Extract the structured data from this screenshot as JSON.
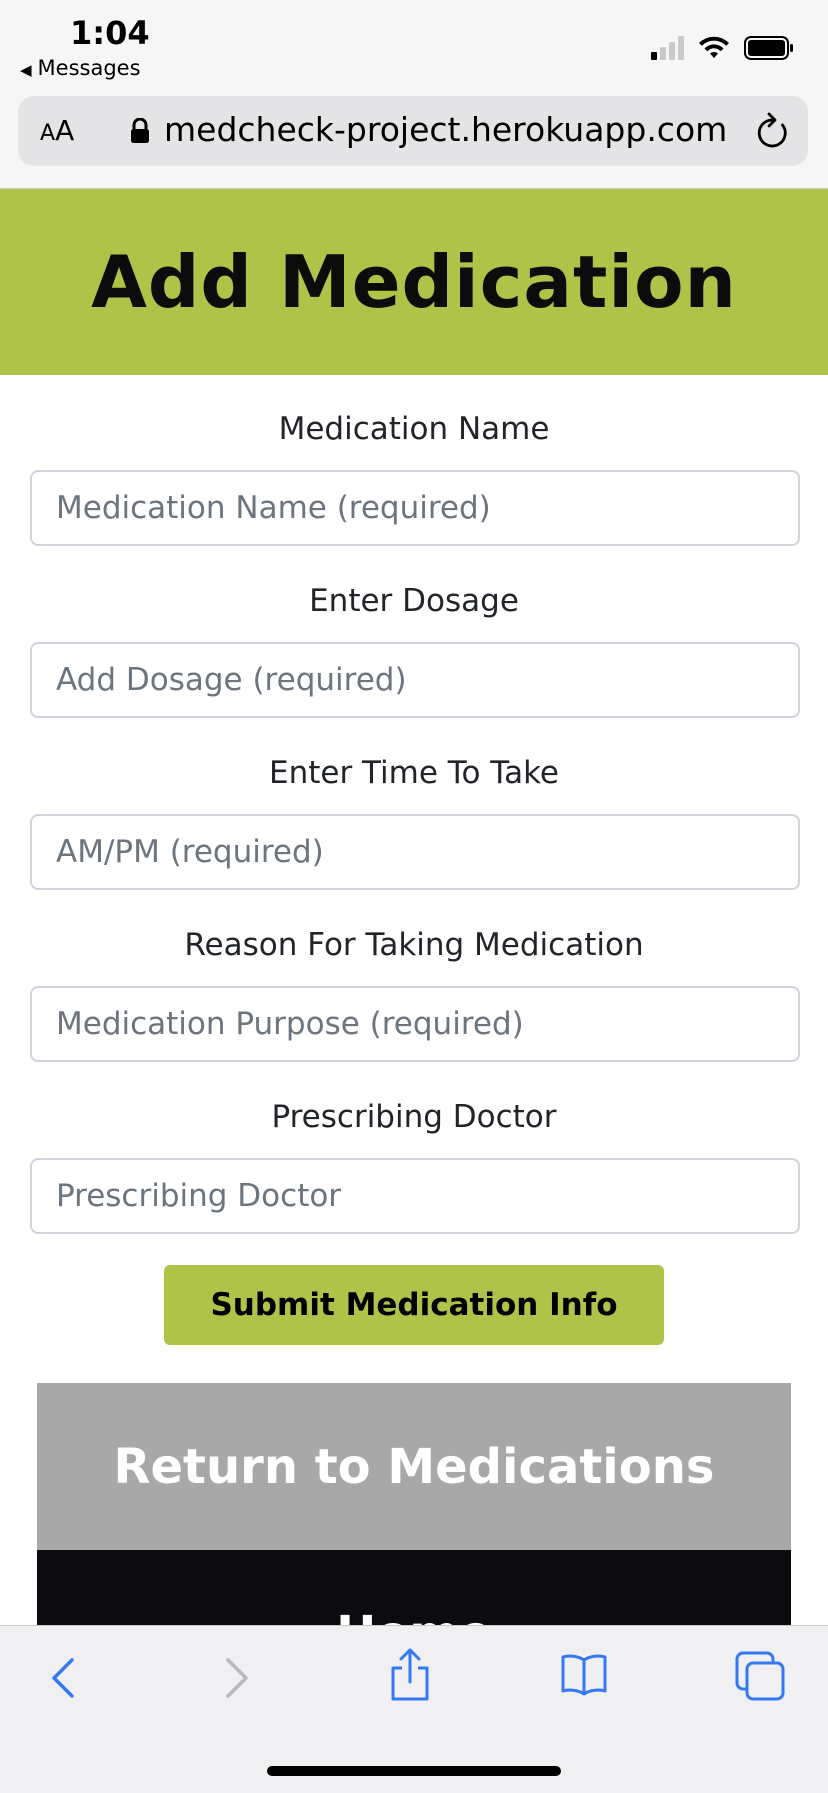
{
  "status_bar": {
    "time": "1:04",
    "back_app": "Messages"
  },
  "browser": {
    "text_size_label_small": "A",
    "text_size_label_large": "A",
    "url": "medcheck-project.herokuapp.com"
  },
  "page": {
    "title": "Add Medication",
    "fields": [
      {
        "label": "Medication Name",
        "placeholder": "Medication Name (required)",
        "value": ""
      },
      {
        "label": "Enter Dosage",
        "placeholder": "Add Dosage (required)",
        "value": ""
      },
      {
        "label": "Enter Time To Take",
        "placeholder": "AM/PM (required)",
        "value": ""
      },
      {
        "label": "Reason For Taking Medication",
        "placeholder": "Medication Purpose (required)",
        "value": ""
      },
      {
        "label": "Prescribing Doctor",
        "placeholder": "Prescribing Doctor",
        "value": ""
      }
    ],
    "submit_label": "Submit Medication Info",
    "return_label": "Return to Medications",
    "home_label": "Home"
  },
  "colors": {
    "accent": "#aec348",
    "return_bg": "#a8a8a8",
    "home_bg": "#0c0c10",
    "ios_blue": "#3478f6"
  },
  "toolbar": {
    "icons": [
      "back-arrow-icon",
      "forward-arrow-icon",
      "share-icon",
      "bookmarks-icon",
      "tabs-icon"
    ]
  }
}
